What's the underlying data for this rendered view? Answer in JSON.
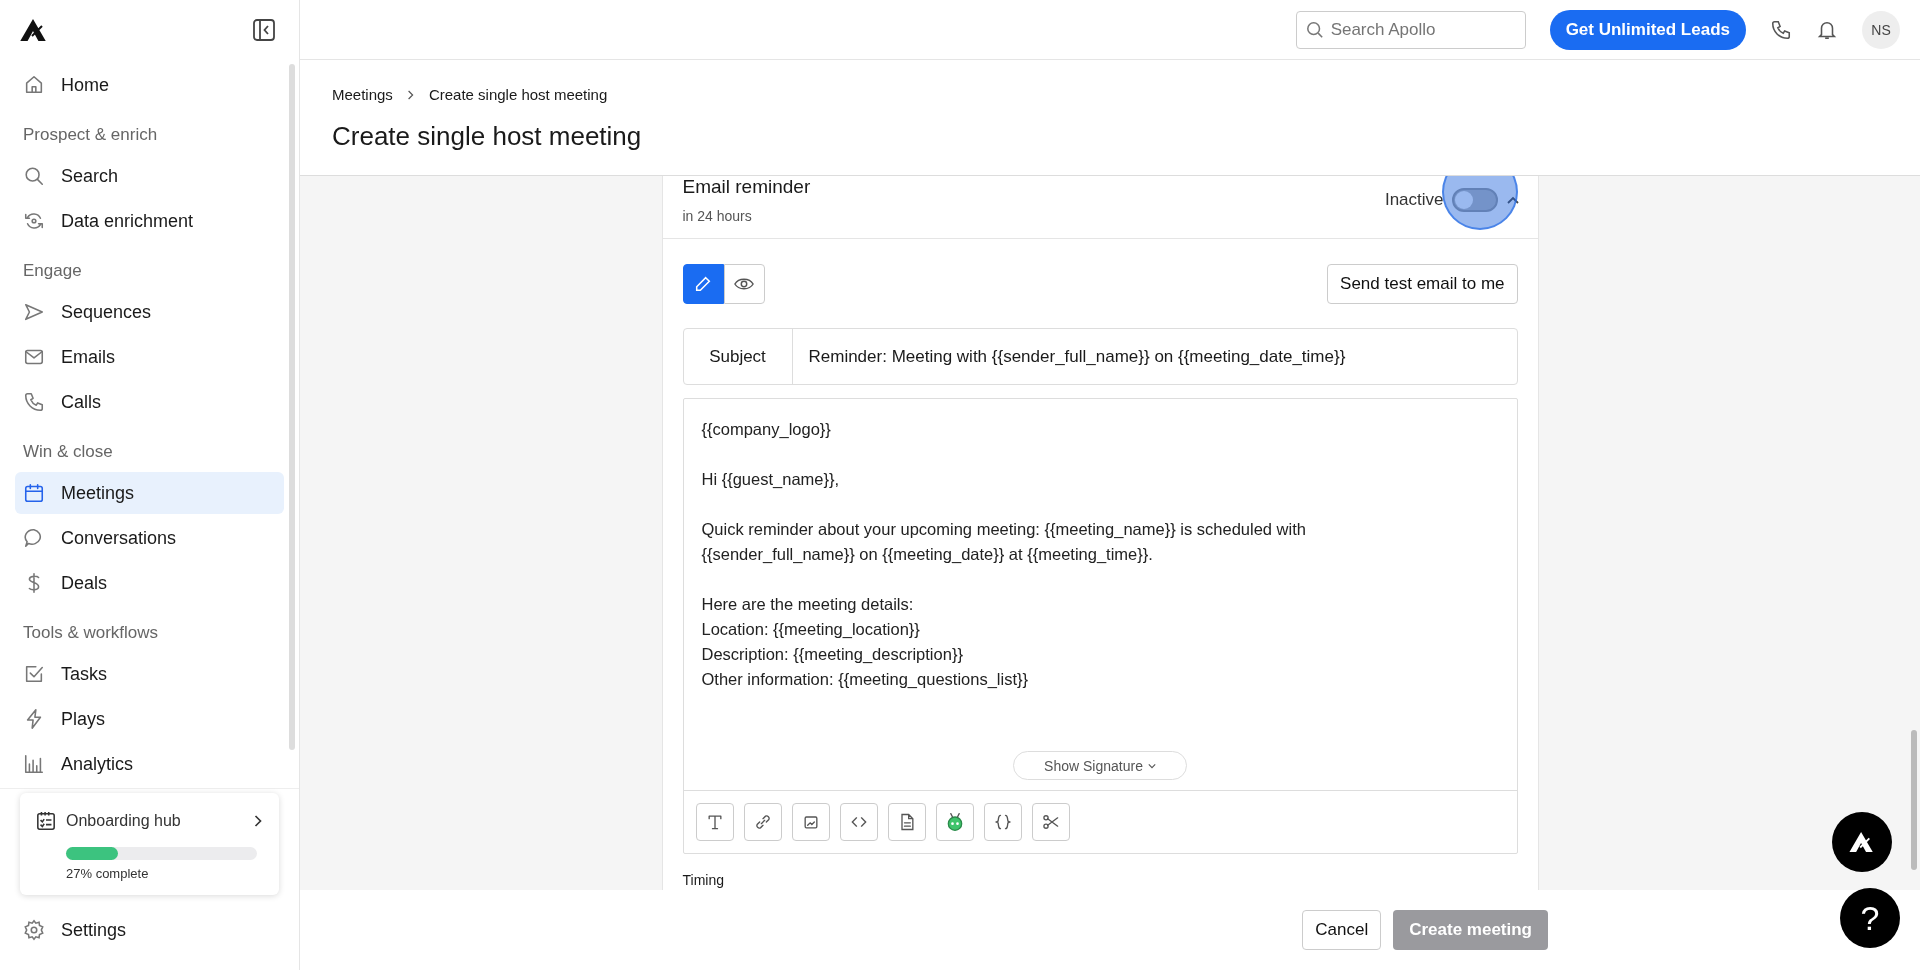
{
  "sidebar": {
    "sections": [
      {
        "items": [
          {
            "label": "Home",
            "selected": false
          }
        ]
      },
      {
        "heading": "Prospect & enrich",
        "items": [
          {
            "label": "Search",
            "selected": false
          },
          {
            "label": "Data enrichment",
            "selected": false
          }
        ]
      },
      {
        "heading": "Engage",
        "items": [
          {
            "label": "Sequences",
            "selected": false
          },
          {
            "label": "Emails",
            "selected": false
          },
          {
            "label": "Calls",
            "selected": false
          }
        ]
      },
      {
        "heading": "Win & close",
        "items": [
          {
            "label": "Meetings",
            "selected": true
          },
          {
            "label": "Conversations",
            "selected": false
          },
          {
            "label": "Deals",
            "selected": false
          }
        ]
      },
      {
        "heading": "Tools & workflows",
        "items": [
          {
            "label": "Tasks",
            "selected": false
          },
          {
            "label": "Plays",
            "selected": false
          },
          {
            "label": "Analytics",
            "selected": false
          }
        ]
      }
    ],
    "onboarding": {
      "title": "Onboarding hub",
      "level": 0.27,
      "progress_text": "27% complete"
    },
    "settings": {
      "label": "Settings"
    }
  },
  "topbar": {
    "search": {
      "placeholder": "Search Apollo"
    },
    "cta": "Get Unlimited Leads",
    "avatar": "NS"
  },
  "breadcrumb": [
    "Meetings",
    "Create single host meeting"
  ],
  "page_title": "Create single host meeting",
  "reminder": {
    "title": "Email reminder",
    "subtitle": "in 24 hours",
    "status": "Inactive",
    "on": false,
    "expanded": true,
    "modes": [
      {
        "kind": "edit",
        "selected": true
      },
      {
        "kind": "preview",
        "selected": false
      }
    ],
    "test_button": "Send test email to me",
    "subject_label": "Subject",
    "subject": "Reminder: Meeting with {{sender_full_name}} on {{meeting_date_time}}",
    "body": [
      [
        "{{company_logo}}"
      ],
      [
        "Hi {{guest_name}},"
      ],
      [
        "Quick reminder about your upcoming meeting: {{meeting_name}} is scheduled with",
        "{{sender_full_name}} on {{meeting_date}} at {{meeting_time}}."
      ],
      [
        "Here are the meeting details:",
        "Location: {{meeting_location}}",
        "Description: {{meeting_description}}",
        "Other information: {{meeting_questions_list}}"
      ]
    ],
    "signature_button": "Show Signature",
    "timing_label": "Timing"
  },
  "footer": {
    "cancel": "Cancel",
    "create": {
      "label": "Create meeting",
      "disabled": true
    }
  },
  "help_button": "?"
}
